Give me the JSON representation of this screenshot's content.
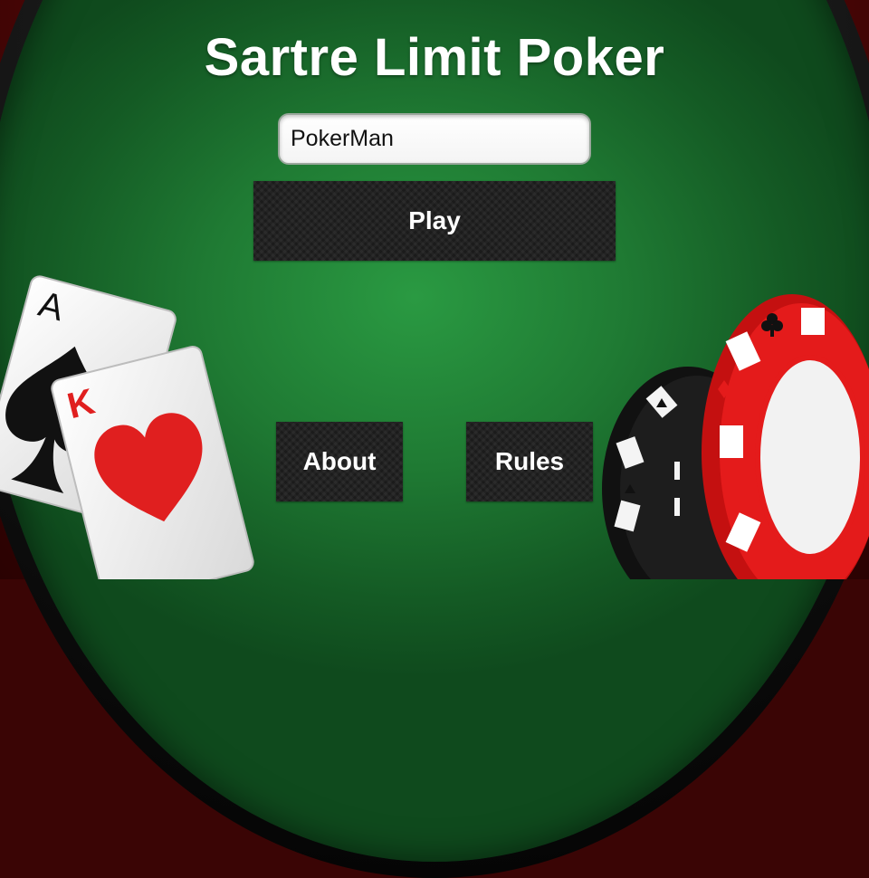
{
  "title": "Sartre Limit Poker",
  "name_input": {
    "value": "PokerMan"
  },
  "buttons": {
    "play": "Play",
    "about": "About",
    "rules": "Rules"
  },
  "cards": {
    "ace": {
      "rank": "A",
      "suit": "spade-icon",
      "color": "#111111"
    },
    "king": {
      "rank": "K",
      "suit": "heart-icon",
      "color": "#e01f1f"
    }
  },
  "colors": {
    "felt": "#1f7a33",
    "button": "#1b1b1b",
    "chip_red": "#e41b1b",
    "chip_black": "#111111"
  }
}
